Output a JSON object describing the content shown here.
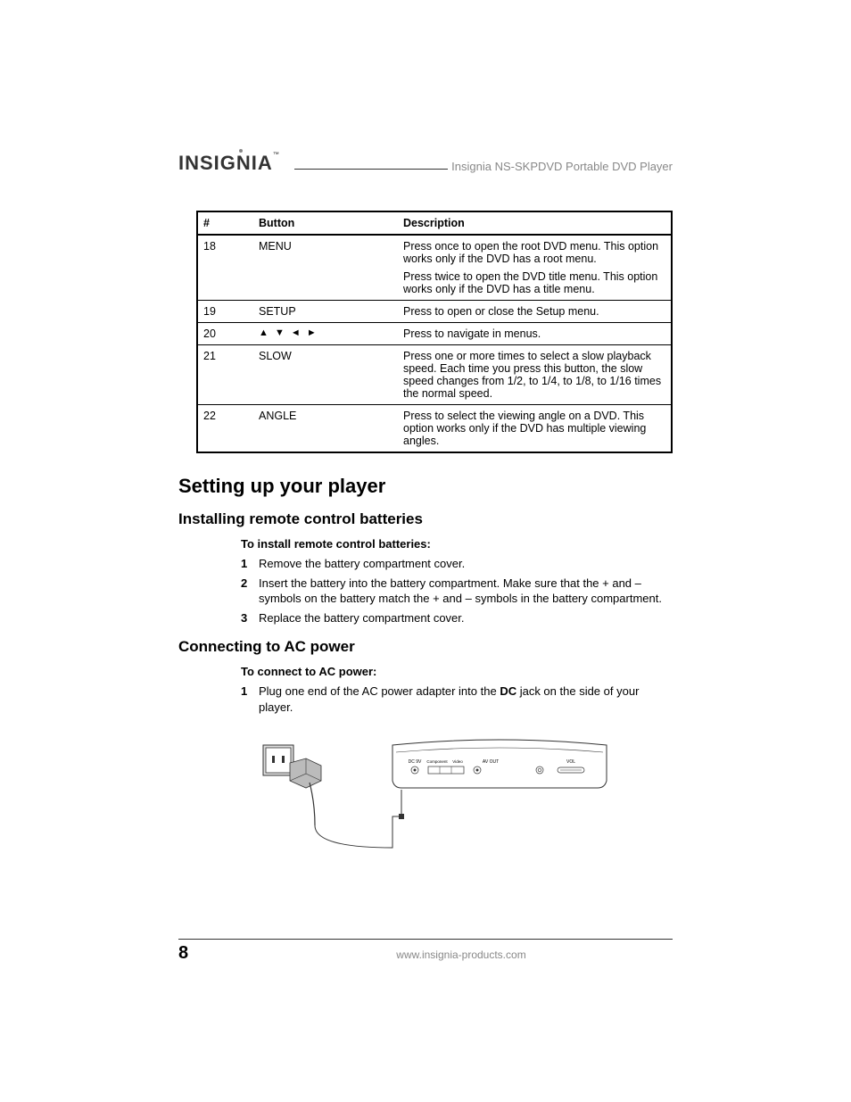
{
  "header": {
    "brand": "INSIGNIA",
    "title": "Insignia NS-SKPDVD Portable DVD Player"
  },
  "table": {
    "headers": {
      "num": "#",
      "button": "Button",
      "desc": "Description"
    },
    "rows": [
      {
        "num": "18",
        "button": "MENU",
        "desc": [
          "Press once to open the root DVD menu. This option works only if the DVD has a root menu.",
          "Press twice to open the DVD title menu. This option works only if the DVD has a title menu."
        ]
      },
      {
        "num": "19",
        "button": "SETUP",
        "desc": [
          "Press to open or close the Setup menu."
        ]
      },
      {
        "num": "20",
        "button": "▲ ▼ ◄ ►",
        "desc": [
          "Press to navigate in menus."
        ]
      },
      {
        "num": "21",
        "button": "SLOW",
        "desc": [
          "Press one or more times to select a slow playback speed. Each time you press this button, the slow speed changes from 1/2, to 1/4, to 1/8, to 1/16 times the normal speed."
        ]
      },
      {
        "num": "22",
        "button": "ANGLE",
        "desc": [
          "Press to select the viewing angle on a DVD. This option works only if the DVD has multiple viewing angles."
        ]
      }
    ]
  },
  "section1": {
    "title": "Setting up your player",
    "sub1": {
      "title": "Installing remote control batteries",
      "lead": "To install remote control batteries:",
      "steps": [
        "Remove the battery compartment cover.",
        "Insert the battery into the battery compartment. Make sure that the + and – symbols on the battery match the + and – symbols in the battery compartment.",
        "Replace the battery compartment cover."
      ]
    },
    "sub2": {
      "title": "Connecting to AC power",
      "lead": "To connect to AC power:",
      "step1_pre": "Plug one end of the AC power adapter into the ",
      "step1_bold": "DC",
      "step1_post": " jack on the side of your player."
    }
  },
  "footer": {
    "page": "8",
    "url": "www.insignia-products.com"
  },
  "diagram_labels": {
    "dc": "DC 9V",
    "comp": "Component",
    "video": "Video",
    "avout": "AV OUT",
    "hp": "",
    "vol": "VOL"
  }
}
